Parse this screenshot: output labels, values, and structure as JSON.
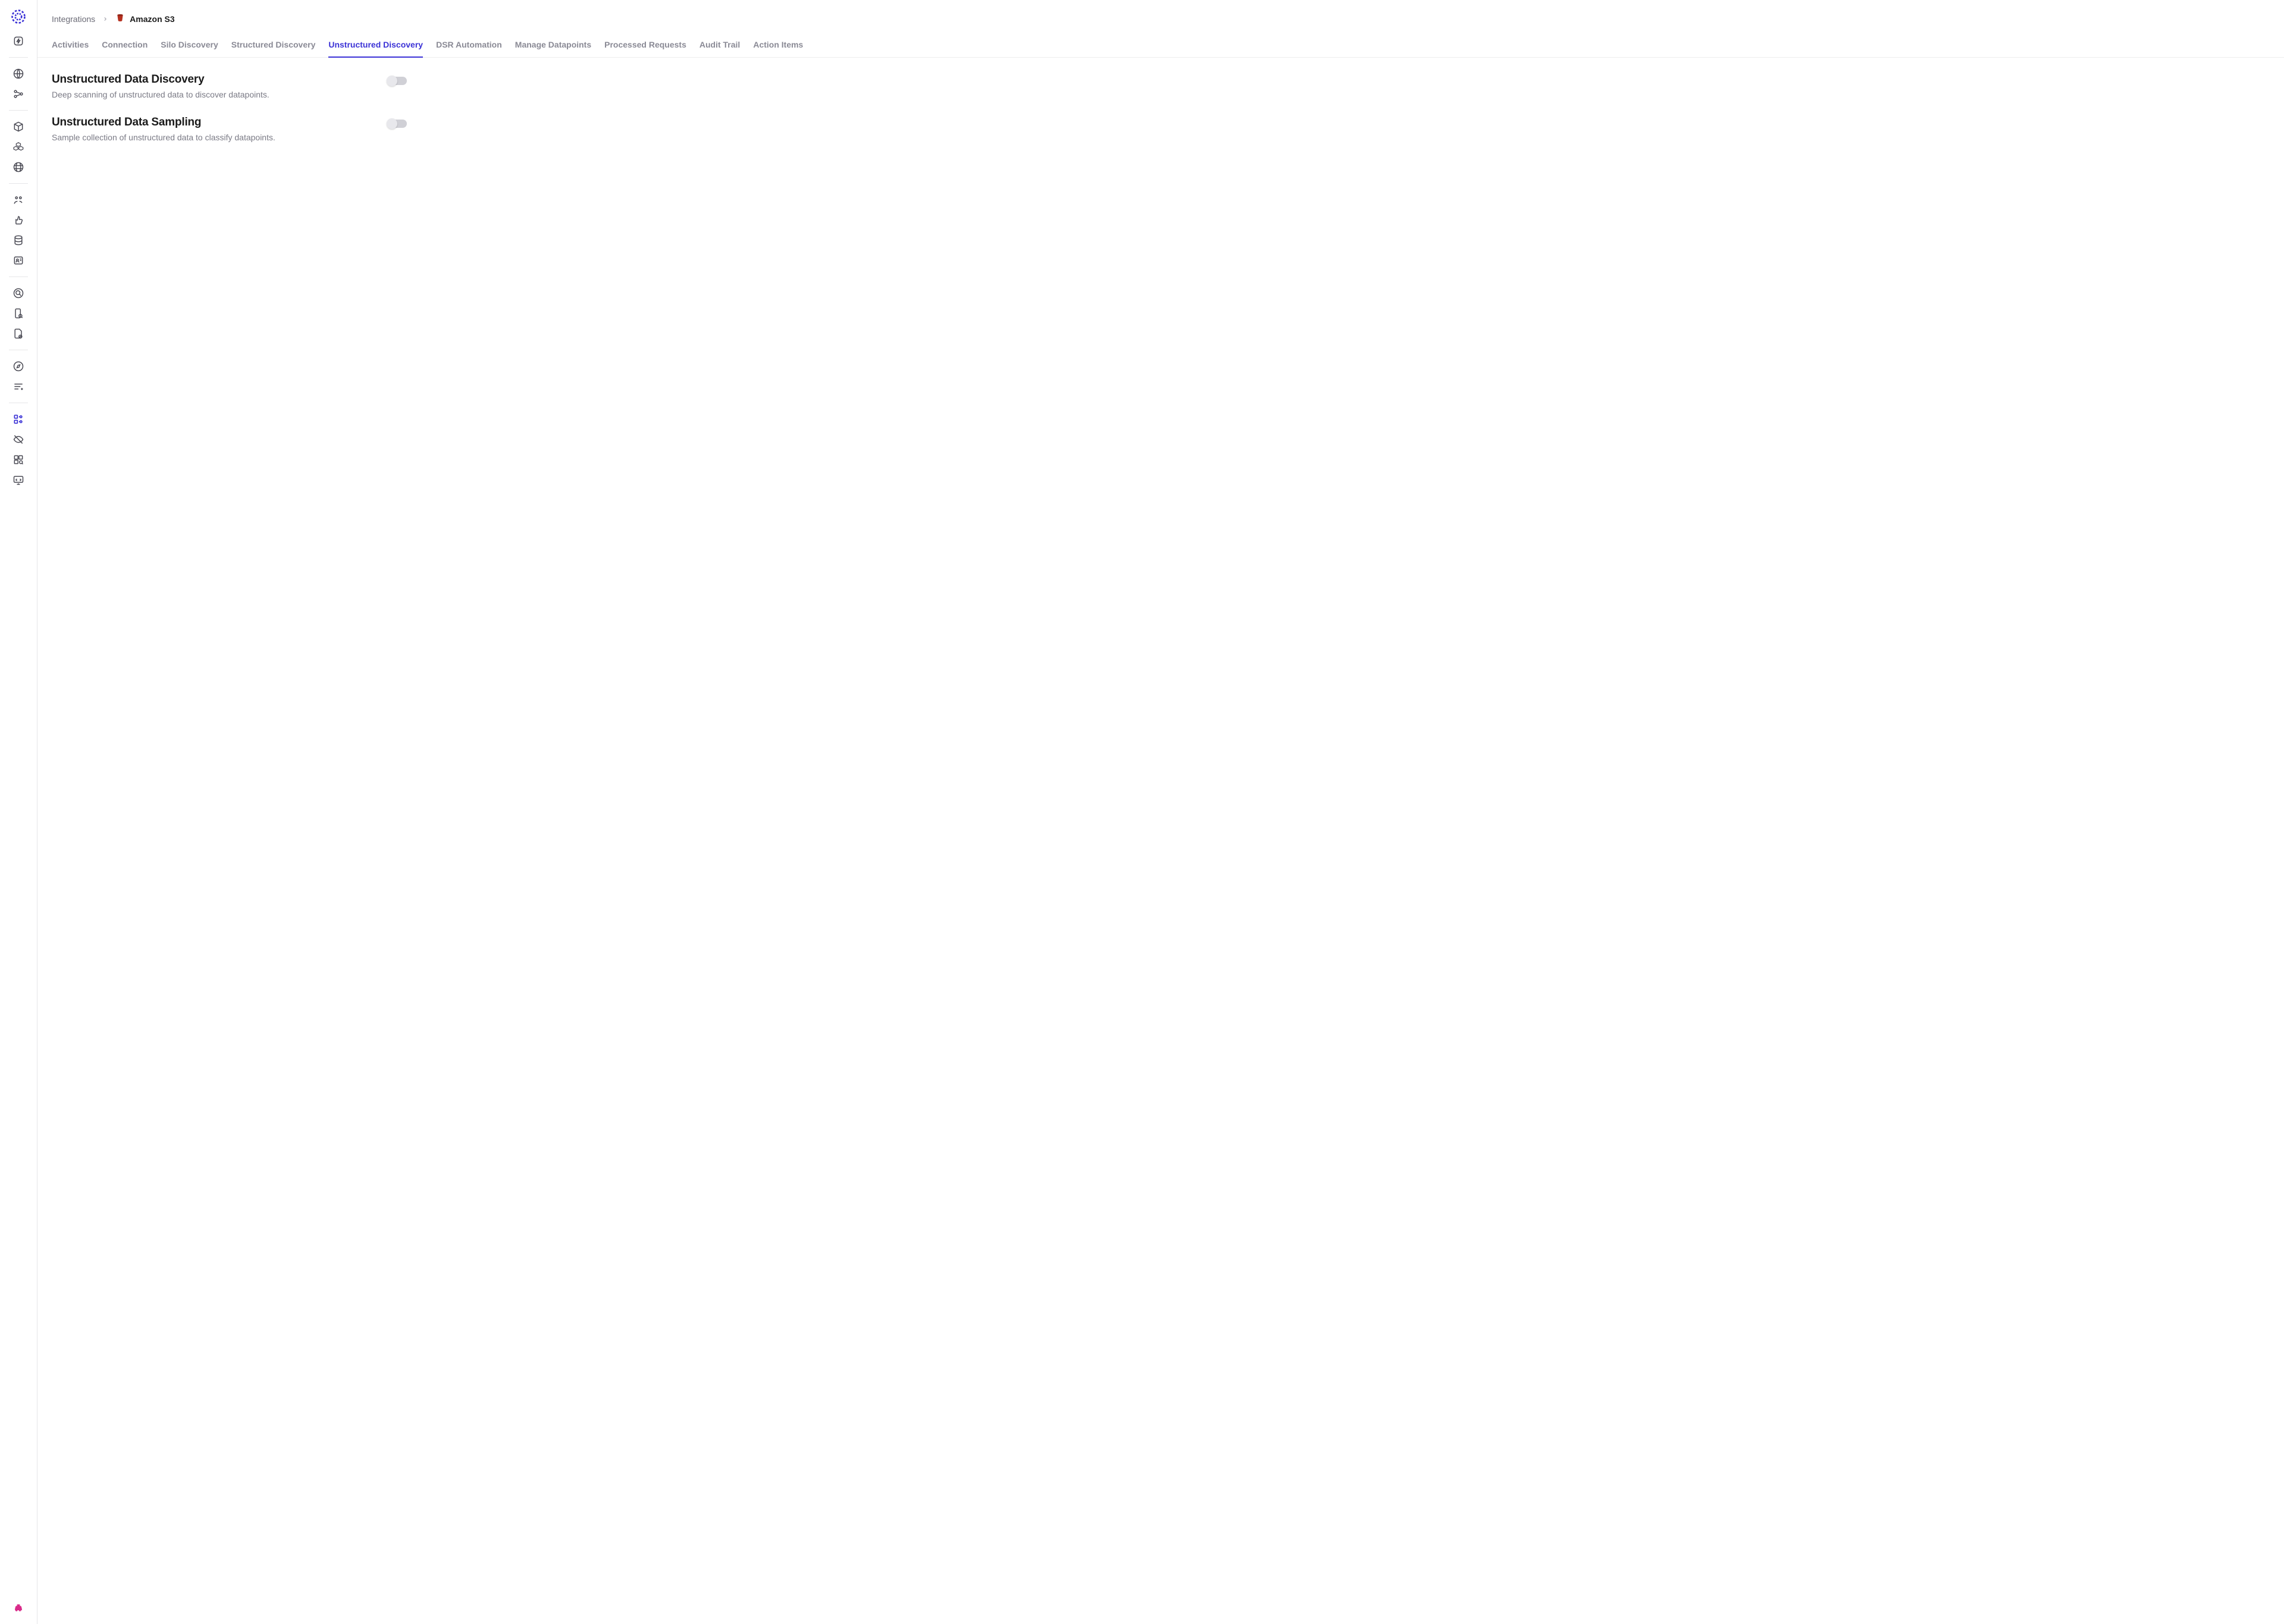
{
  "breadcrumb": {
    "root": "Integrations",
    "current": "Amazon S3"
  },
  "tabs": [
    {
      "label": "Activities"
    },
    {
      "label": "Connection"
    },
    {
      "label": "Silo Discovery"
    },
    {
      "label": "Structured Discovery"
    },
    {
      "label": "Unstructured Discovery",
      "active": true
    },
    {
      "label": "DSR Automation"
    },
    {
      "label": "Manage Datapoints"
    },
    {
      "label": "Processed Requests"
    },
    {
      "label": "Audit Trail"
    },
    {
      "label": "Action Items"
    }
  ],
  "settings": [
    {
      "title": "Unstructured Data Discovery",
      "desc": "Deep scanning of unstructured data to discover datapoints.",
      "enabled": false
    },
    {
      "title": "Unstructured Data Sampling",
      "desc": "Sample collection of unstructured data to classify datapoints.",
      "enabled": false
    }
  ],
  "sidebar": {
    "icons": [
      "lightning-icon",
      "globe-icon",
      "share-nodes-icon",
      "cube-icon",
      "cubes-icon",
      "globe-lines-icon",
      "user-share-icon",
      "thumbs-up-icon",
      "database-icon",
      "id-card-icon",
      "search-doc-icon",
      "phone-search-icon",
      "file-blocked-icon",
      "compass-icon",
      "list-filter-icon",
      "grid-tiles-icon",
      "eye-off-icon",
      "plugin-icon",
      "code-monitor-icon"
    ],
    "active_icon": "grid-tiles-icon",
    "bottom_icon": "car-icon"
  }
}
